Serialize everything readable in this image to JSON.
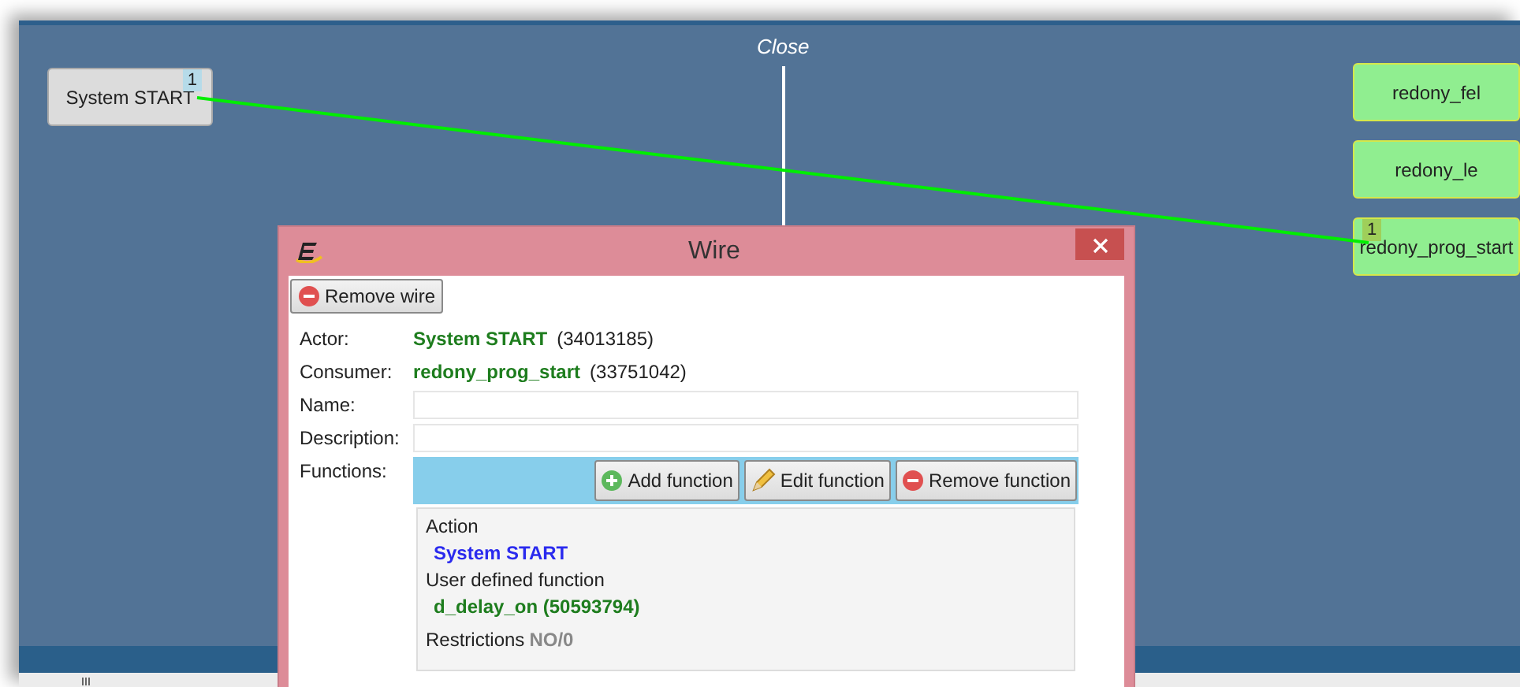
{
  "canvas": {
    "caption": "Close",
    "nodes": [
      {
        "label": "System START",
        "kind": "source",
        "badge": "1"
      },
      {
        "label": "redony_fel",
        "kind": "target"
      },
      {
        "label": "redony_le",
        "kind": "target"
      },
      {
        "label": "redony_prog_start",
        "kind": "target",
        "badge": "1"
      }
    ]
  },
  "dialog": {
    "title": "Wire",
    "remove_button": "Remove wire",
    "fields": [
      {
        "label": "Actor:",
        "kind": "link",
        "value": "System START",
        "extra": "(34013185)"
      },
      {
        "label": "Consumer:",
        "kind": "link",
        "value": "redony_prog_start",
        "extra": "(33751042)"
      },
      {
        "label": "Name:",
        "kind": "input"
      },
      {
        "label": "Description:",
        "kind": "input"
      }
    ],
    "functions": {
      "label": "Functions:",
      "buttons": [
        {
          "label": "Add function",
          "kind": "add"
        },
        {
          "label": "Edit function",
          "kind": "edit"
        },
        {
          "label": "Remove function",
          "kind": "remove"
        }
      ],
      "details": [
        {
          "kind": "action",
          "heading": "Action",
          "value": "System START"
        },
        {
          "kind": "function",
          "heading": "User defined function",
          "value": "d_delay_on (50593794)"
        },
        {
          "kind": "restrictions",
          "heading": "Restrictions",
          "value": "NO/0"
        }
      ]
    }
  }
}
